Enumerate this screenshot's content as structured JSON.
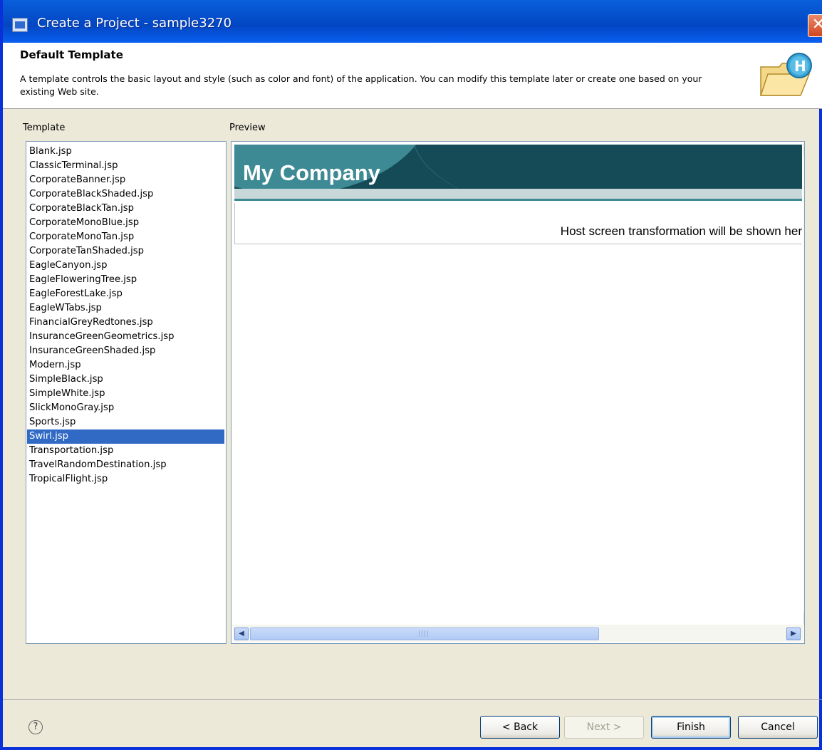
{
  "window": {
    "title": "Create a Project - sample3270",
    "close_label": "✕"
  },
  "banner": {
    "title": "Default Template",
    "description": "A template controls the basic layout and style (such as color and font) of the application. You can modify this template later or create one based on your existing Web site."
  },
  "template_list": {
    "label": "Template",
    "items": [
      "Blank.jsp",
      "ClassicTerminal.jsp",
      "CorporateBanner.jsp",
      "CorporateBlackShaded.jsp",
      "CorporateBlackTan.jsp",
      "CorporateMonoBlue.jsp",
      "CorporateMonoTan.jsp",
      "CorporateTanShaded.jsp",
      "EagleCanyon.jsp",
      "EagleFloweringTree.jsp",
      "EagleForestLake.jsp",
      "EagleWTabs.jsp",
      "FinancialGreyRedtones.jsp",
      "InsuranceGreenGeometrics.jsp",
      "InsuranceGreenShaded.jsp",
      "Modern.jsp",
      "SimpleBlack.jsp",
      "SimpleWhite.jsp",
      "SlickMonoGray.jsp",
      "Sports.jsp",
      "Swirl.jsp",
      "Transportation.jsp",
      "TravelRandomDestination.jsp",
      "TropicalFlight.jsp"
    ],
    "selected": "Swirl.jsp"
  },
  "preview": {
    "label": "Preview",
    "company_name": "My Company",
    "placeholder_text": "Host screen transformation will be shown her"
  },
  "buttons": {
    "back": "< Back",
    "next": "Next >",
    "finish": "Finish",
    "cancel": "Cancel"
  },
  "colors": {
    "title_bar": "#0246c3",
    "selection": "#316ac5",
    "preview_header": "#144b56",
    "preview_accent": "#3d8a95"
  }
}
